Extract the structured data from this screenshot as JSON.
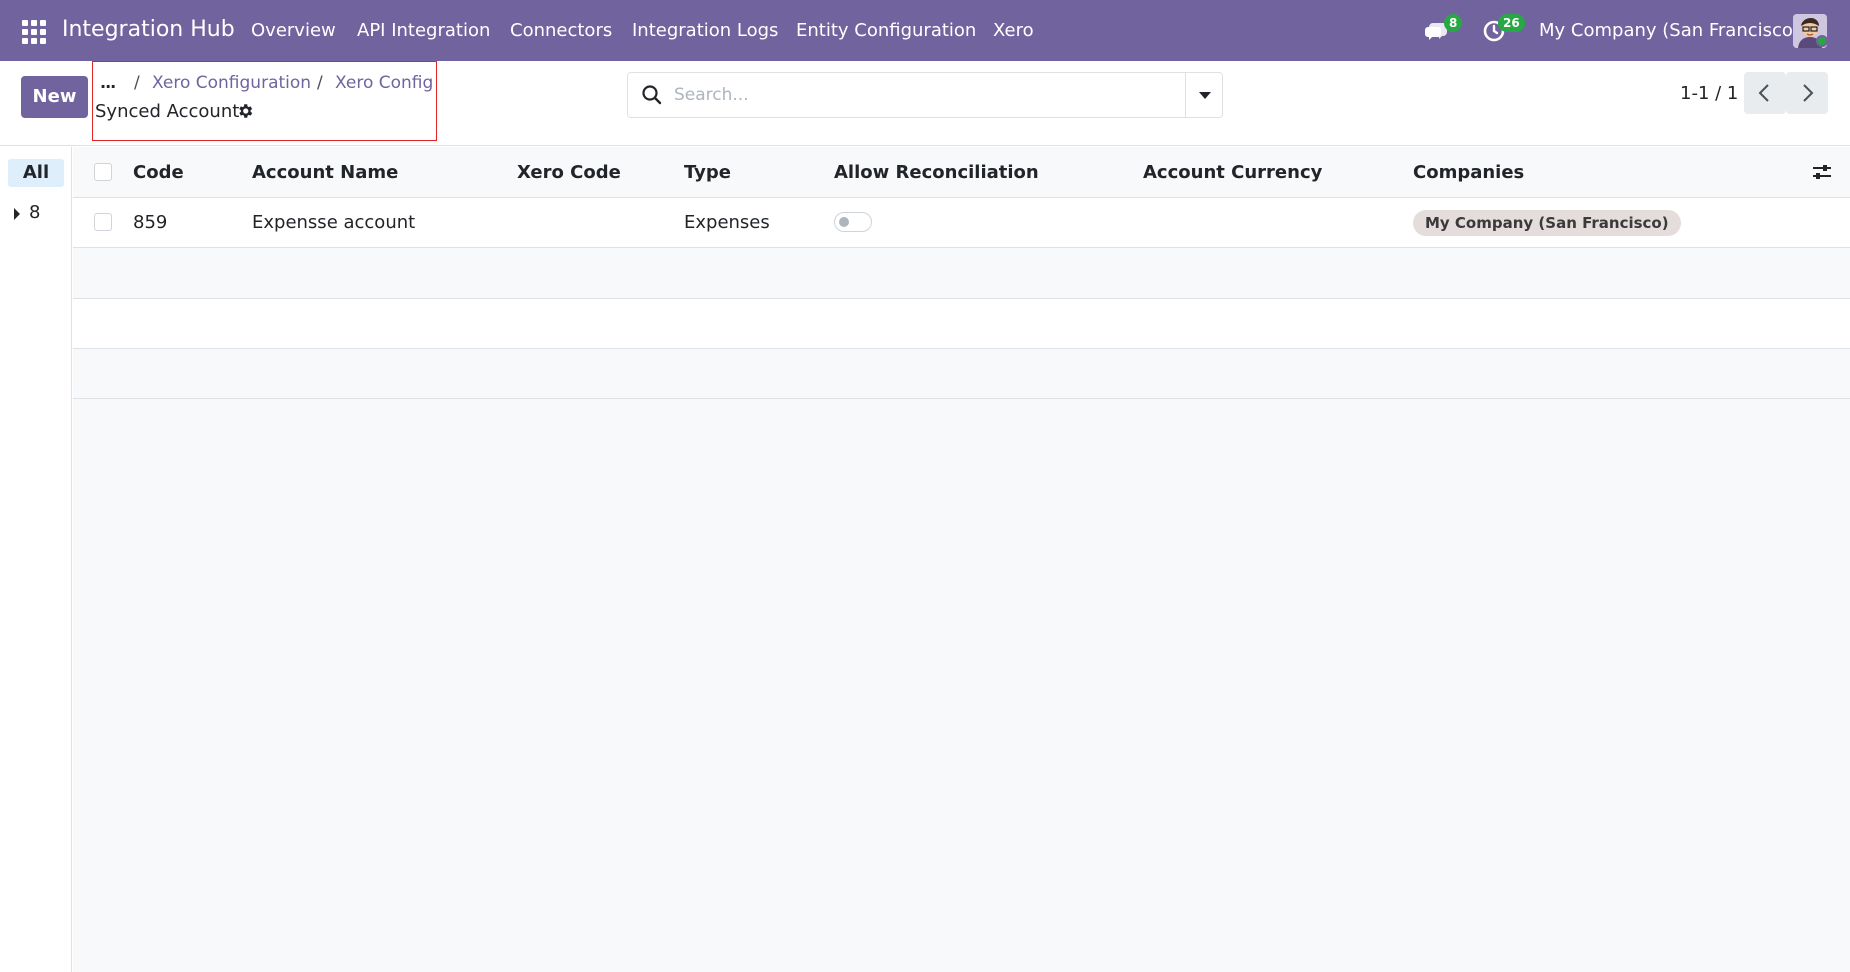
{
  "navbar": {
    "app_name": "Integration Hub",
    "menu": [
      "Overview",
      "API Integration",
      "Connectors",
      "Integration Logs",
      "Entity Configuration",
      "Xero"
    ],
    "messages_count": "8",
    "activities_count": "26",
    "company": "My Company (San Francisco)",
    "background_color": "#71639e",
    "badge_color": "#28a745"
  },
  "control_panel": {
    "new_button": "New",
    "breadcrumb": {
      "ellipsis": "...",
      "separator": "/",
      "items": [
        "Xero Configuration",
        "Xero Config"
      ],
      "current": "Synced Account"
    },
    "search": {
      "placeholder": "Search...",
      "value": ""
    },
    "pager": {
      "value": "1-1 / 1"
    }
  },
  "side_panel": {
    "all_label": "All",
    "group_value": "8"
  },
  "list": {
    "columns": [
      "Code",
      "Account Name",
      "Xero Code",
      "Type",
      "Allow Reconciliation",
      "Account Currency",
      "Companies"
    ],
    "rows": [
      {
        "code": "859",
        "account_name": "Expensse account",
        "xero_code": "",
        "type": "Expenses",
        "allow_reconciliation": false,
        "account_currency": "",
        "companies": [
          "My Company (San Francisco)"
        ]
      }
    ]
  },
  "icons": [
    "apps-grid-icon",
    "chat-icon",
    "clock-icon",
    "avatar-icon",
    "gear-icon",
    "search-icon",
    "caret-down-icon",
    "chevron-left-icon",
    "chevron-right-icon",
    "caret-right-icon",
    "column-options-icon"
  ]
}
